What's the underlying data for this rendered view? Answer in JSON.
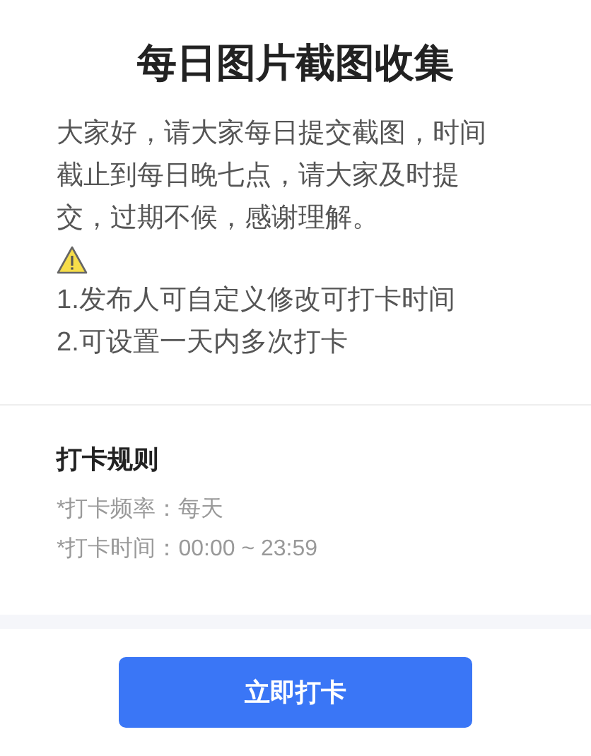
{
  "title": "每日图片截图收集",
  "description": "大家好，请大家每日提交截图，时间截止到每日晚七点，请大家及时提交，过期不候，感谢理解。",
  "notice_lines": [
    "1.发布人可自定义修改可打卡时间",
    "2.可设置一天内多次打卡"
  ],
  "rules": {
    "title": "打卡规则",
    "items": [
      "*打卡频率：每天",
      "*打卡时间：00:00 ~ 23:59"
    ]
  },
  "button": "立即打卡"
}
